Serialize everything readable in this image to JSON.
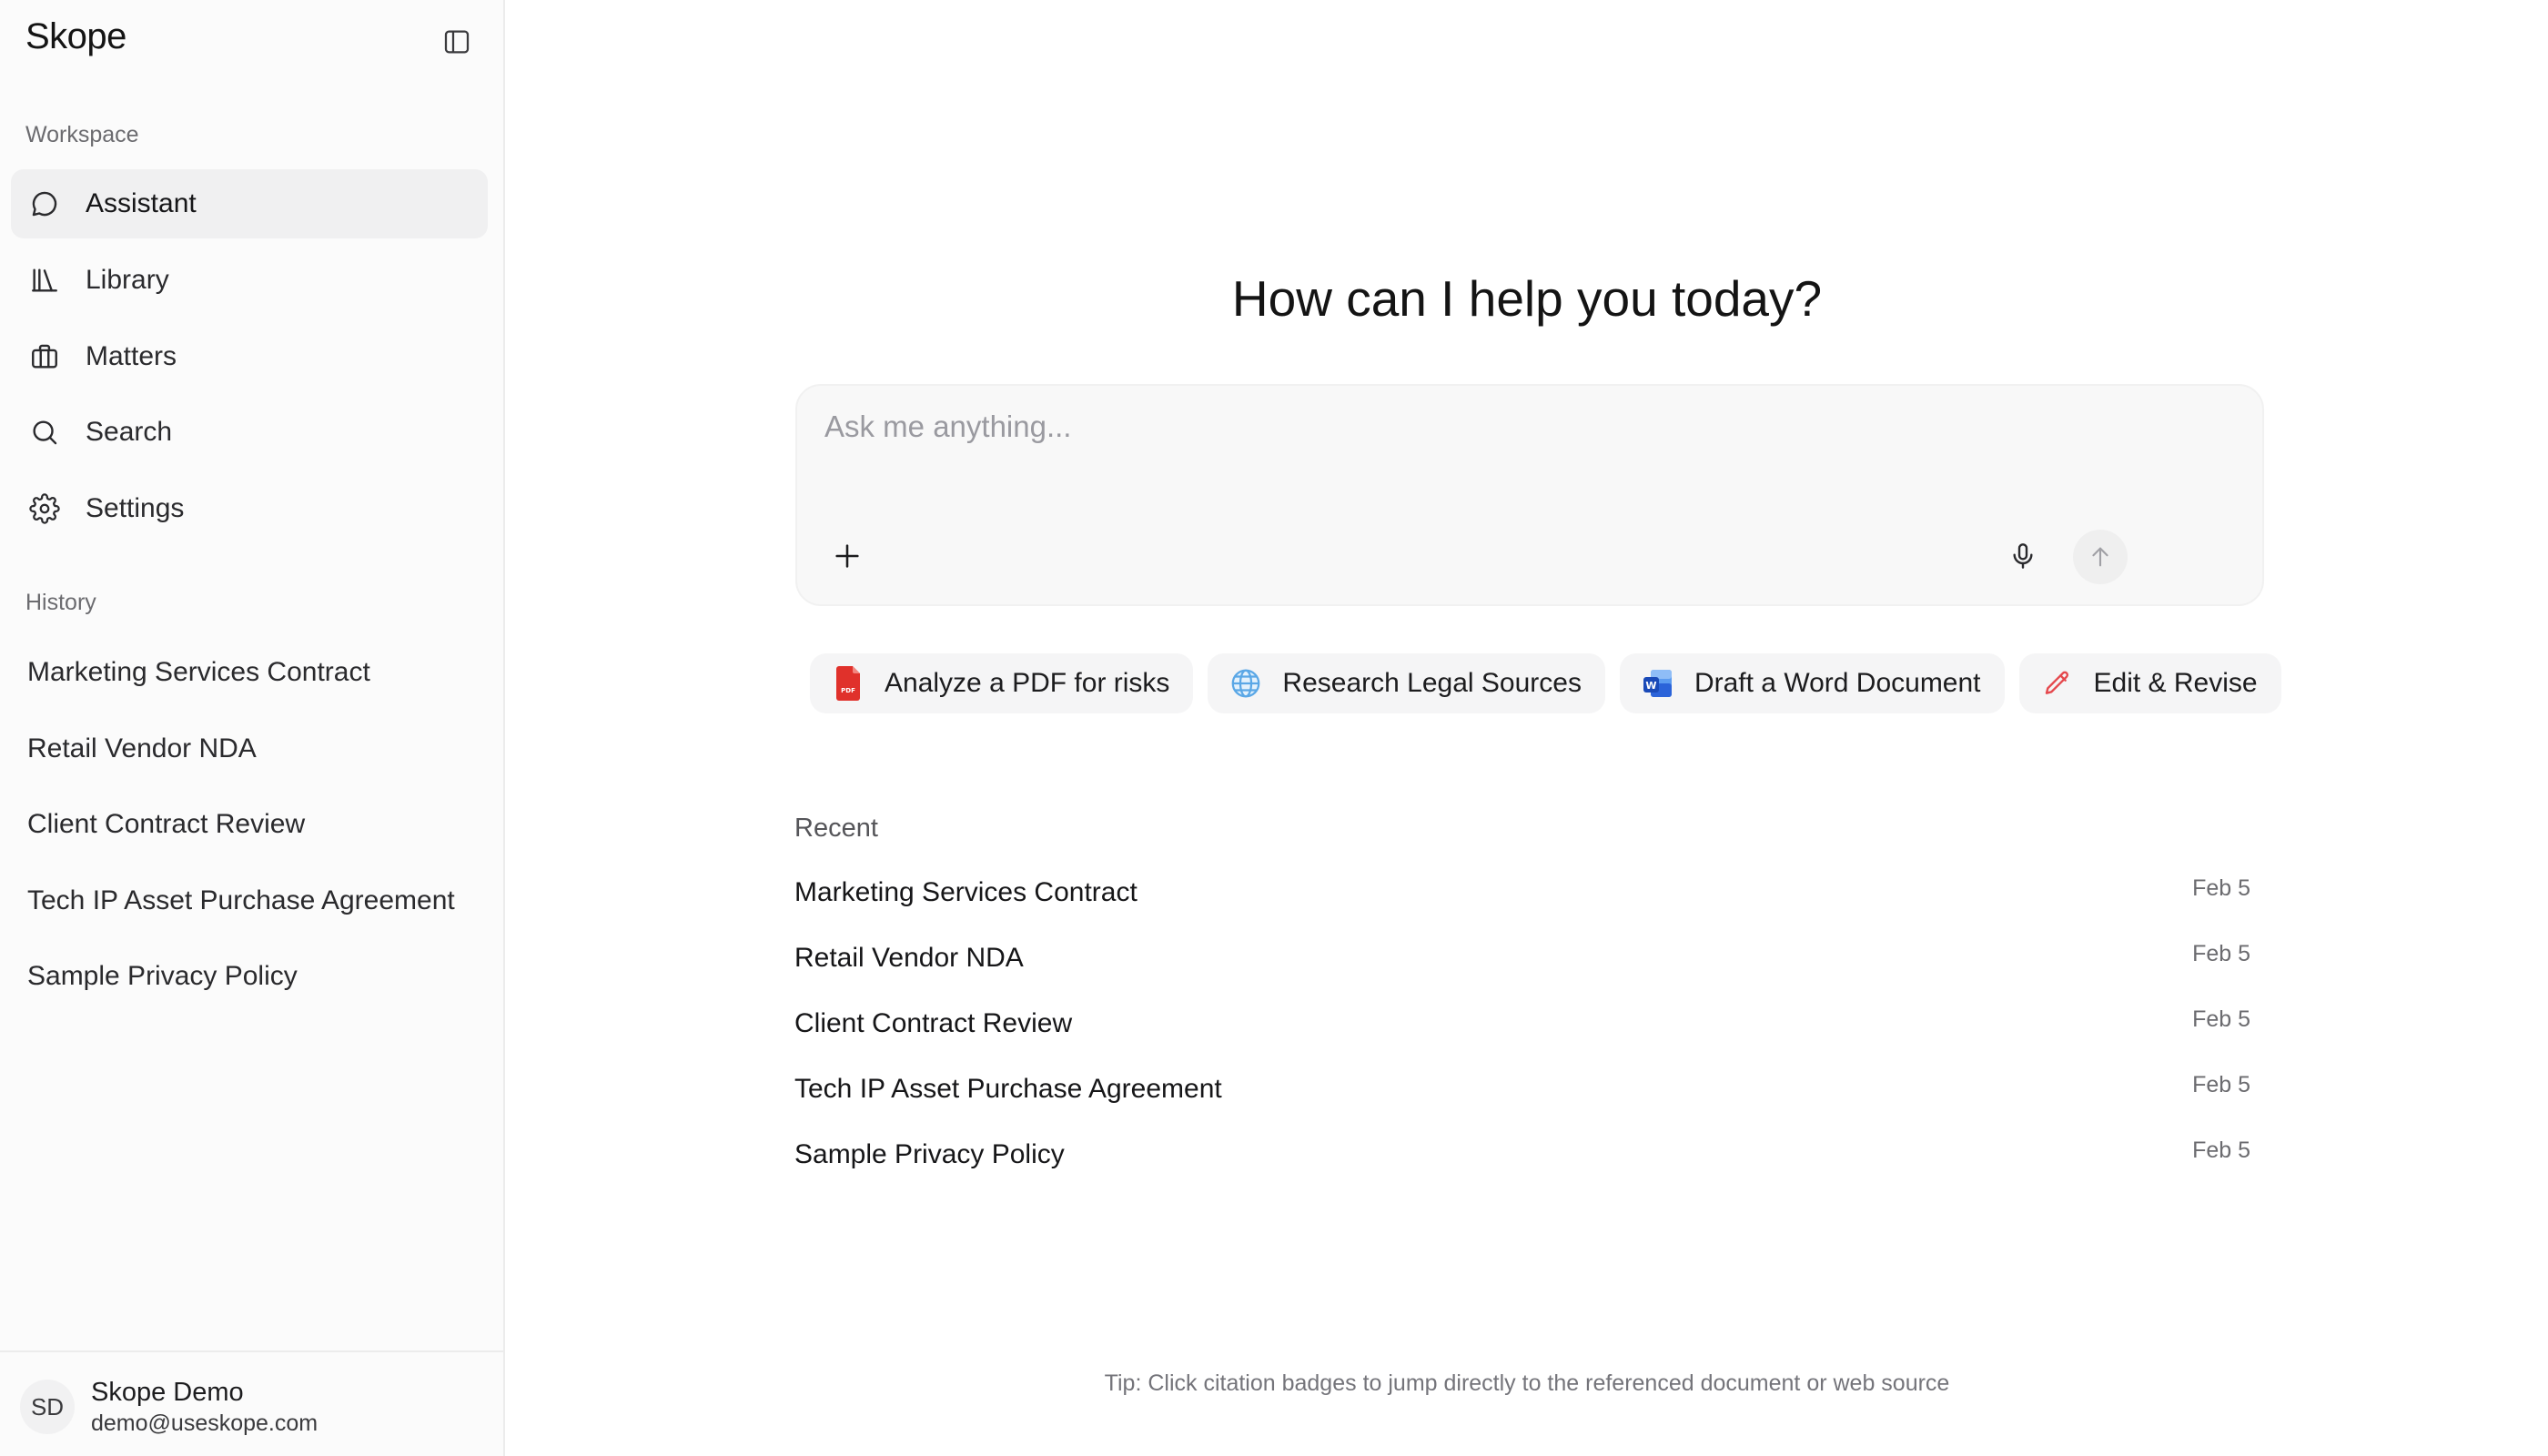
{
  "app": {
    "name": "Skope"
  },
  "sidebar": {
    "workspace_label": "Workspace",
    "nav": [
      {
        "label": "Assistant",
        "icon": "chat-bubble-icon",
        "active": true
      },
      {
        "label": "Library",
        "icon": "library-icon"
      },
      {
        "label": "Matters",
        "icon": "briefcase-icon"
      },
      {
        "label": "Search",
        "icon": "search-icon"
      },
      {
        "label": "Settings",
        "icon": "gear-icon"
      }
    ],
    "history_label": "History",
    "history": [
      "Marketing Services Contract",
      "Retail Vendor NDA",
      "Client Contract Review",
      "Tech IP Asset Purchase Agreement",
      "Sample Privacy Policy"
    ],
    "user": {
      "initials": "SD",
      "name": "Skope Demo",
      "email": "demo@useskope.com"
    }
  },
  "main": {
    "greeting": "How can I help you today?",
    "composer": {
      "placeholder": "Ask me anything...",
      "value": ""
    },
    "chips": [
      {
        "label": "Analyze a PDF for risks",
        "icon": "pdf-file-icon"
      },
      {
        "label": "Research Legal Sources",
        "icon": "globe-icon"
      },
      {
        "label": "Draft a Word Document",
        "icon": "word-doc-icon"
      },
      {
        "label": "Edit & Revise",
        "icon": "pencil-icon"
      }
    ],
    "recent_label": "Recent",
    "recent": [
      {
        "title": "Marketing Services Contract",
        "date": "Feb 5"
      },
      {
        "title": "Retail Vendor NDA",
        "date": "Feb 5"
      },
      {
        "title": "Client Contract Review",
        "date": "Feb 5"
      },
      {
        "title": "Tech IP Asset Purchase Agreement",
        "date": "Feb 5"
      },
      {
        "title": "Sample Privacy Policy",
        "date": "Feb 5"
      }
    ],
    "tip": "Tip: Click citation badges to jump directly to the referenced document or web source"
  },
  "colors": {
    "pdf_red": "#e0312b",
    "word_blue": "#2b63d9",
    "pencil_red": "#e5484d",
    "globe_blue": "#5aa7e6"
  }
}
